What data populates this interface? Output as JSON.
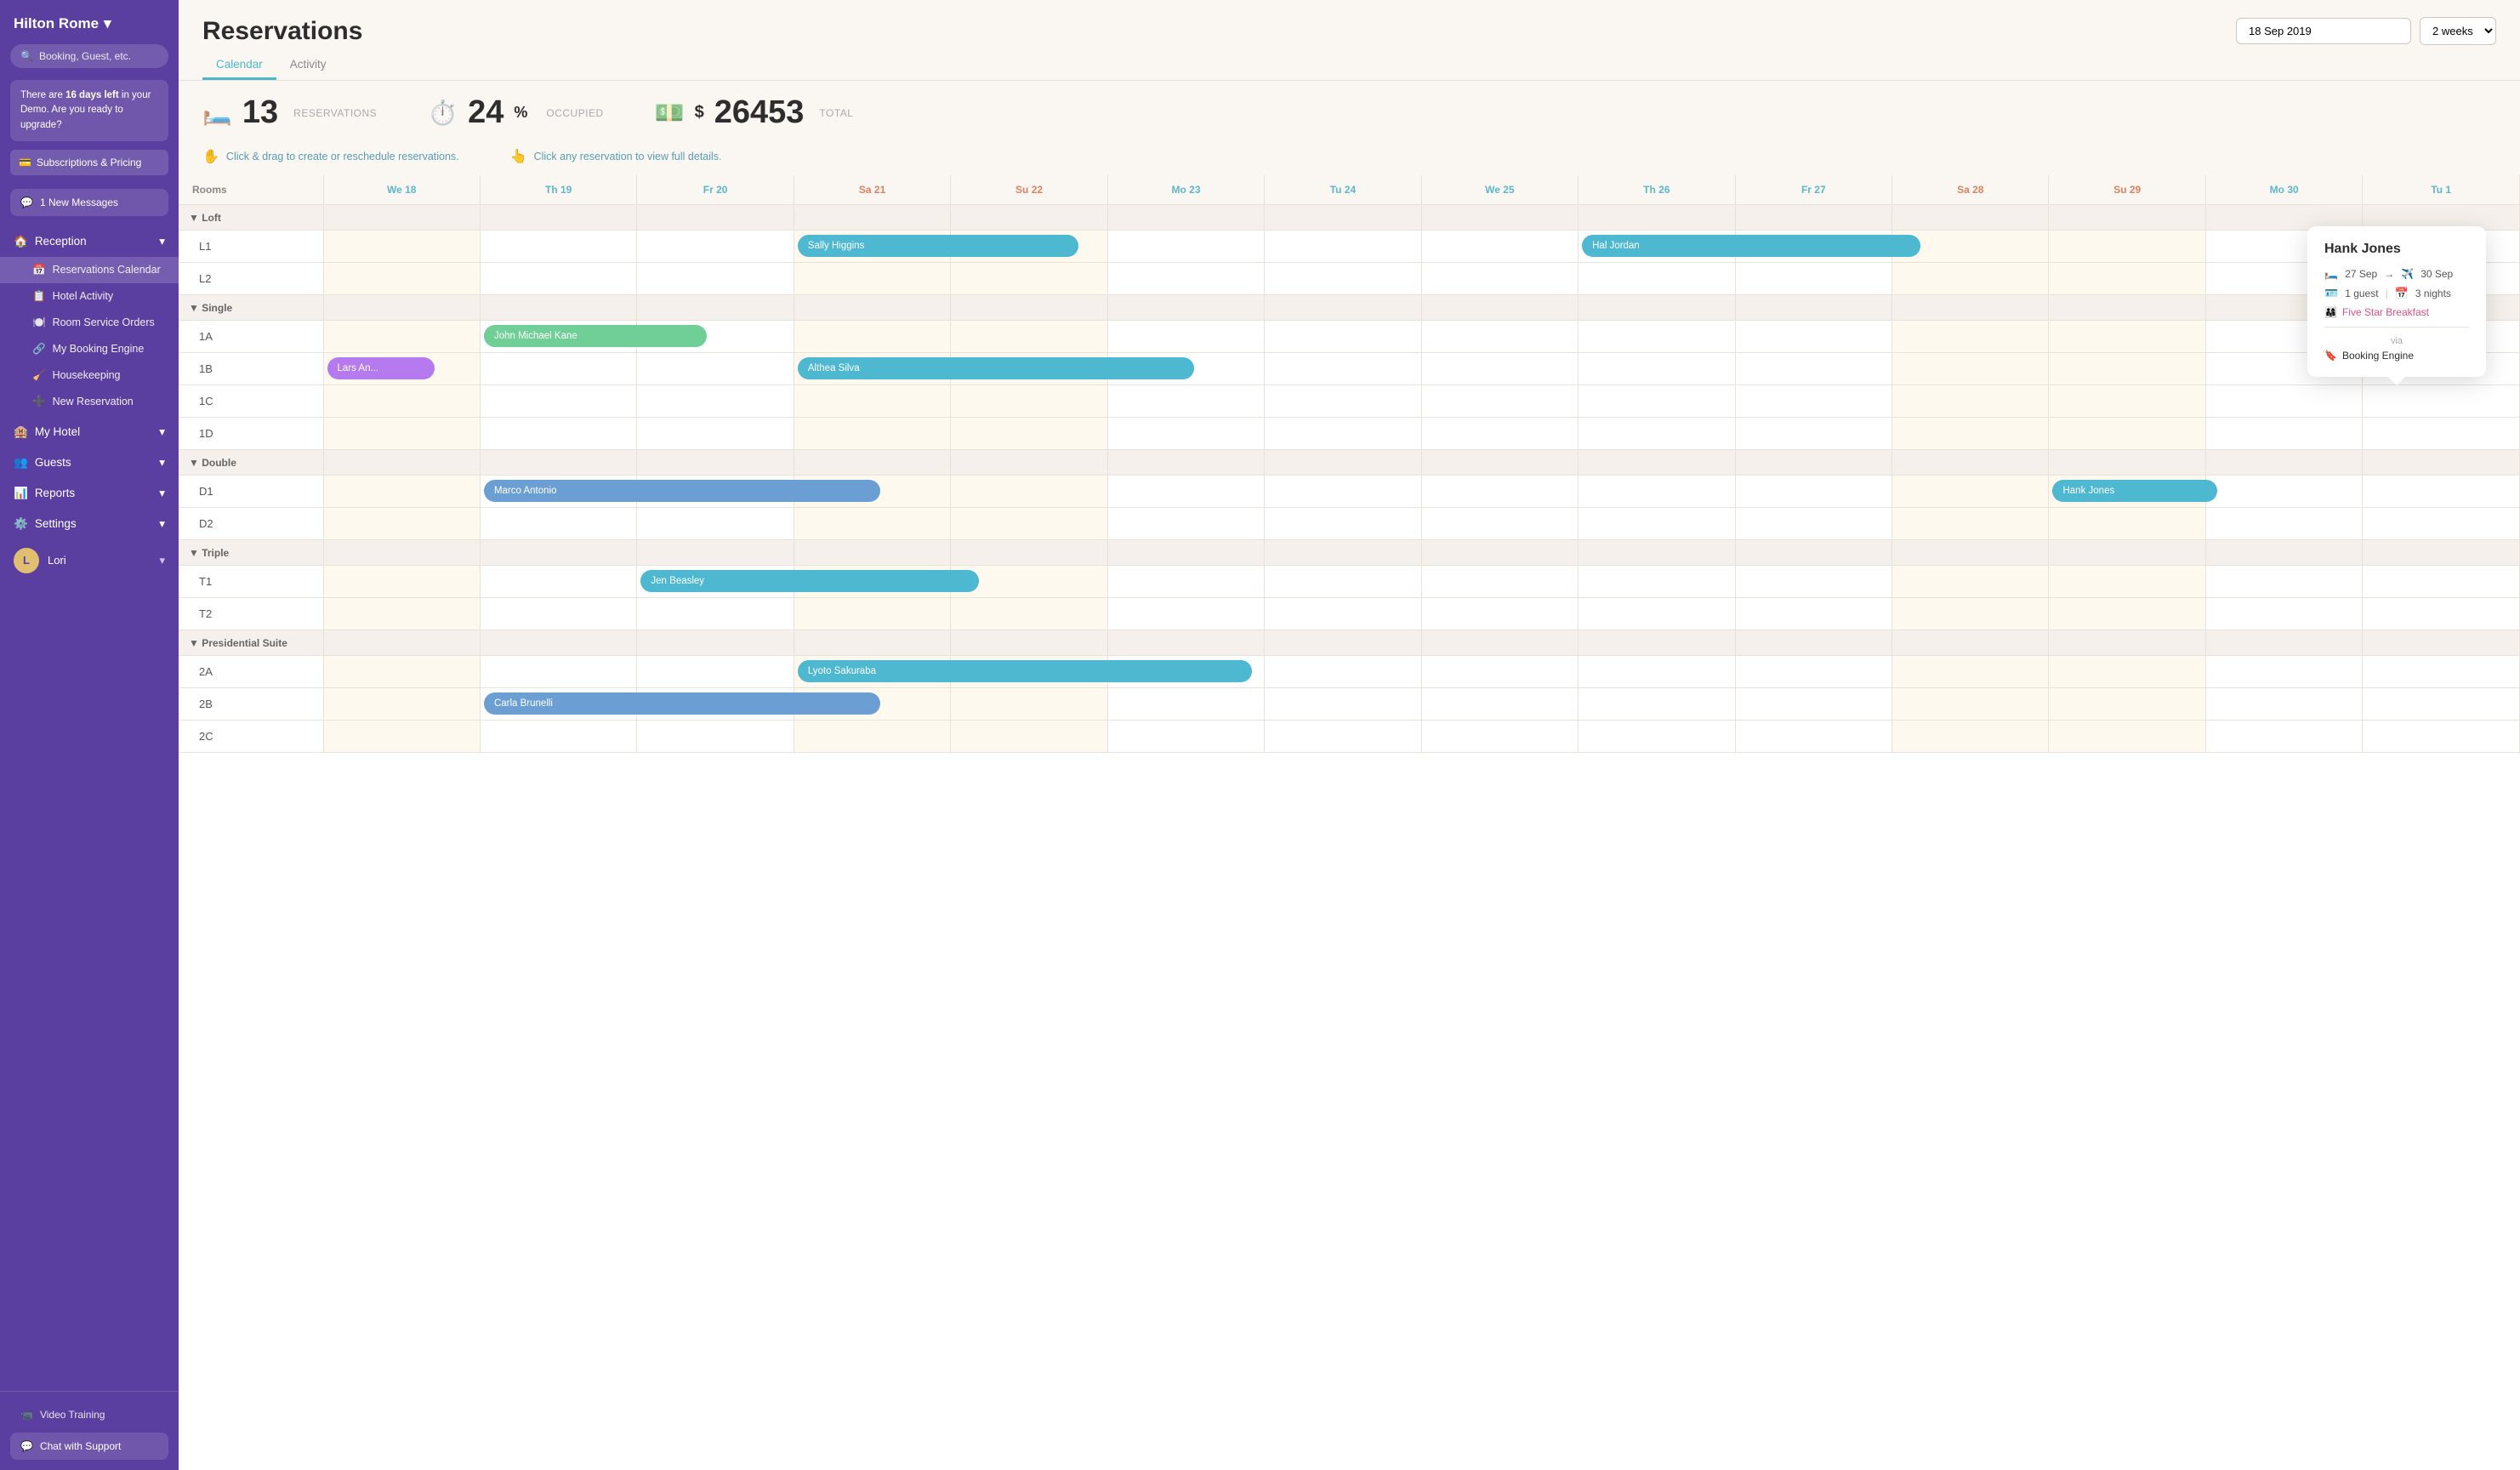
{
  "hotel": {
    "name": "Hilton Rome",
    "chevron": "▾"
  },
  "sidebar": {
    "search_placeholder": "Booking, Guest, etc.",
    "demo_text_1": "There are ",
    "demo_days": "16 days left",
    "demo_text_2": " in your Demo. Are you ready to upgrade?",
    "upgrade_btn": "Subscriptions & Pricing",
    "messages_btn": "1 New Messages",
    "nav": [
      {
        "id": "reception",
        "label": "Reception",
        "icon": "🏠",
        "expanded": true,
        "children": [
          {
            "id": "reservations-calendar",
            "label": "Reservations Calendar",
            "icon": "📅",
            "active": true
          },
          {
            "id": "hotel-activity",
            "label": "Hotel Activity",
            "icon": "📋"
          },
          {
            "id": "room-service-orders",
            "label": "Room Service Orders",
            "icon": "🍽️"
          },
          {
            "id": "my-booking-engine",
            "label": "My Booking Engine",
            "icon": "🔗"
          },
          {
            "id": "housekeeping",
            "label": "Housekeeping",
            "icon": "🧹"
          },
          {
            "id": "new-reservation",
            "label": "New Reservation",
            "icon": "➕"
          }
        ]
      },
      {
        "id": "my-hotel",
        "label": "My Hotel",
        "icon": "🏨",
        "expanded": false,
        "children": []
      },
      {
        "id": "guests",
        "label": "Guests",
        "icon": "👥",
        "expanded": false,
        "children": []
      },
      {
        "id": "reports",
        "label": "Reports",
        "icon": "📊",
        "expanded": false,
        "children": []
      },
      {
        "id": "settings",
        "label": "Settings",
        "icon": "⚙️",
        "expanded": false,
        "children": []
      }
    ],
    "user": "Lori",
    "video_training": "Video Training",
    "chat_support": "Chat with Support"
  },
  "page": {
    "title": "Reservations",
    "tabs": [
      "Calendar",
      "Activity"
    ],
    "active_tab": "Calendar",
    "date": "18 Sep 2019",
    "view": "2 weeks"
  },
  "stats": {
    "reservations_count": "13",
    "reservations_label": "RESERVATIONS",
    "occupied_pct": "24",
    "occupied_label": "OCCUPIED",
    "total_amount": "26453",
    "total_label": "TOTAL"
  },
  "hints": {
    "drag": "Click & drag to create or reschedule reservations.",
    "click": "Click any reservation to view full details."
  },
  "calendar": {
    "columns": [
      {
        "label": "We 18",
        "id": "we18",
        "weekend": false,
        "today": true
      },
      {
        "label": "Th 19",
        "id": "th19",
        "weekend": false,
        "today": false
      },
      {
        "label": "Fr 20",
        "id": "fr20",
        "weekend": false,
        "today": false
      },
      {
        "label": "Sa 21",
        "id": "sa21",
        "weekend": true,
        "today": false
      },
      {
        "label": "Su 22",
        "id": "su22",
        "weekend": true,
        "today": false
      },
      {
        "label": "Mo 23",
        "id": "mo23",
        "weekend": false,
        "today": false
      },
      {
        "label": "Tu 24",
        "id": "tu24",
        "weekend": false,
        "today": false
      },
      {
        "label": "We 25",
        "id": "we25",
        "weekend": false,
        "today": false
      },
      {
        "label": "Th 26",
        "id": "th26",
        "weekend": false,
        "today": false
      },
      {
        "label": "Fr 27",
        "id": "fr27",
        "weekend": false,
        "today": false
      },
      {
        "label": "Sa 28",
        "id": "sa28",
        "weekend": true,
        "today": false
      },
      {
        "label": "Su 29",
        "id": "su29",
        "weekend": true,
        "today": false
      },
      {
        "label": "Mo 30",
        "id": "mo30",
        "weekend": false,
        "today": false
      },
      {
        "label": "Tu 1",
        "id": "tu1",
        "weekend": false,
        "today": false
      }
    ],
    "categories": [
      {
        "name": "Loft",
        "rooms": [
          {
            "id": "L1",
            "bars": [
              {
                "label": "Sally Higgins",
                "start": 4,
                "span": 5,
                "color": "bar-cyan"
              },
              {
                "label": "Hal Jordan",
                "start": 9,
                "span": 6,
                "color": "bar-cyan"
              }
            ]
          },
          {
            "id": "L2",
            "bars": []
          }
        ]
      },
      {
        "name": "Single",
        "rooms": [
          {
            "id": "1A",
            "bars": [
              {
                "label": "John Michael Kane",
                "start": 2,
                "span": 4,
                "color": "bar-green"
              }
            ]
          },
          {
            "id": "1B",
            "bars": [
              {
                "label": "Lars An...",
                "start": 1,
                "span": 2,
                "color": "bar-purple"
              },
              {
                "label": "Althea Silva",
                "start": 4,
                "span": 7,
                "color": "bar-cyan"
              }
            ]
          },
          {
            "id": "1C",
            "bars": []
          },
          {
            "id": "1D",
            "bars": []
          }
        ]
      },
      {
        "name": "Double",
        "rooms": [
          {
            "id": "D1",
            "bars": [
              {
                "label": "Marco Antonio",
                "start": 2,
                "span": 7,
                "color": "bar-blue"
              },
              {
                "label": "Hank Jones",
                "start": 12,
                "span": 3,
                "color": "bar-cyan"
              }
            ]
          },
          {
            "id": "D2",
            "bars": []
          }
        ]
      },
      {
        "name": "Triple",
        "rooms": [
          {
            "id": "T1",
            "bars": [
              {
                "label": "Jen Beasley",
                "start": 3,
                "span": 6,
                "color": "bar-cyan"
              }
            ]
          },
          {
            "id": "T2",
            "bars": []
          }
        ]
      },
      {
        "name": "Presidential Suite",
        "rooms": [
          {
            "id": "2A",
            "bars": [
              {
                "label": "Lyoto Sakuraba",
                "start": 4,
                "span": 8,
                "color": "bar-cyan"
              }
            ]
          },
          {
            "id": "2B",
            "bars": [
              {
                "label": "Carla Brunelli",
                "start": 2,
                "span": 7,
                "color": "bar-blue"
              }
            ]
          },
          {
            "id": "2C",
            "bars": []
          }
        ]
      }
    ]
  },
  "popup": {
    "name": "Hank Jones",
    "check_in": "27 Sep",
    "check_out": "30 Sep",
    "guests": "1 guest",
    "nights": "3 nights",
    "package": "Five Star Breakfast",
    "via": "via",
    "source": "Booking Engine"
  }
}
